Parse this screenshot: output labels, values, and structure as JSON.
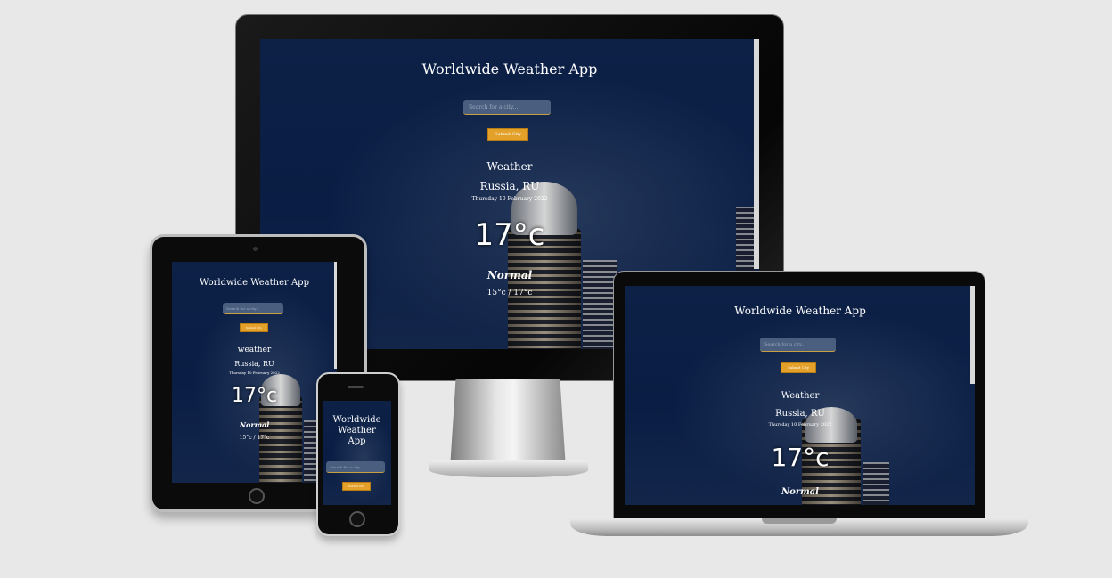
{
  "app": {
    "title": "Worldwide Weather App",
    "title_phone_line1": "Worldwide",
    "title_phone_line2": "Weather",
    "title_phone_line3": "App",
    "search_placeholder": "Search for a city...",
    "submit_label": "Submit City",
    "heading": "Weather",
    "heading_tablet": "weather",
    "location": "Russia, RU",
    "date": "Thursday 10 February 2022",
    "temperature": "17°c",
    "condition": "Normal",
    "range": "15°c / 17°c"
  },
  "colors": {
    "background": "#e8e8e8",
    "screen_bg": "#0a1d44",
    "button": "#e3a129",
    "search_bg": "#4a5f80"
  }
}
